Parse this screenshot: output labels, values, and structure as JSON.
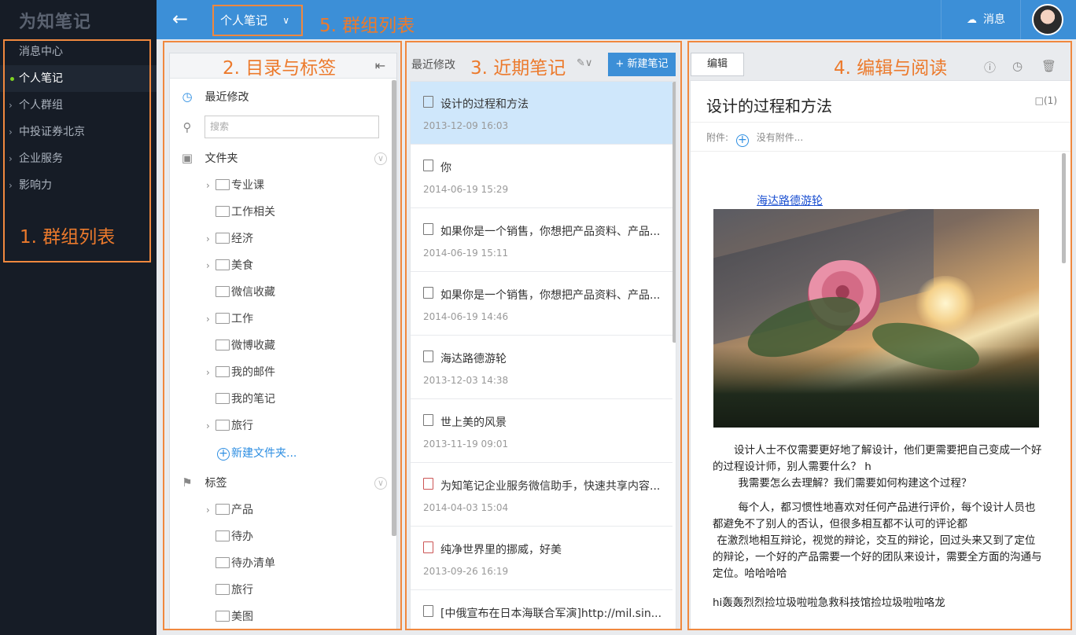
{
  "app": {
    "logo": "为知笔记"
  },
  "sidebar": {
    "items": [
      {
        "label": "消息中心",
        "chevron": false,
        "active": false
      },
      {
        "label": "个人笔记",
        "chevron": false,
        "active": true
      },
      {
        "label": "个人群组",
        "chevron": true,
        "active": false
      },
      {
        "label": "中投证券北京",
        "chevron": true,
        "active": false
      },
      {
        "label": "企业服务",
        "chevron": true,
        "active": false
      },
      {
        "label": "影响力",
        "chevron": true,
        "active": false
      }
    ]
  },
  "annotations": {
    "a1": "1. 群组列表",
    "a2": "2. 目录与标签",
    "a3": "3. 近期笔记",
    "a4": "4. 编辑与阅读",
    "a5": "5. 群组列表",
    "color": "#f0883e"
  },
  "topbar": {
    "back_icon": "←",
    "group_selected": "个人笔记",
    "message_label": "消息",
    "accent": "#3c8fd7"
  },
  "directory": {
    "recent_label": "最近修改",
    "search_placeholder": "搜索",
    "folders_label": "文件夹",
    "folders": [
      {
        "label": "专业课",
        "chevron": true
      },
      {
        "label": "工作相关",
        "chevron": false
      },
      {
        "label": "经济",
        "chevron": true
      },
      {
        "label": "美食",
        "chevron": true
      },
      {
        "label": "微信收藏",
        "chevron": false
      },
      {
        "label": "工作",
        "chevron": true
      },
      {
        "label": "微博收藏",
        "chevron": false
      },
      {
        "label": "我的邮件",
        "chevron": true
      },
      {
        "label": "我的笔记",
        "chevron": false
      },
      {
        "label": "旅行",
        "chevron": true
      }
    ],
    "new_folder_label": "新建文件夹...",
    "tags_label": "标签",
    "tags": [
      {
        "label": "产品",
        "chevron": true
      },
      {
        "label": "待办",
        "chevron": false
      },
      {
        "label": "待办清单",
        "chevron": false
      },
      {
        "label": "旅行",
        "chevron": false
      },
      {
        "label": "美图",
        "chevron": false
      }
    ]
  },
  "notes": {
    "header": "最近修改",
    "new_note_label": "+ 新建笔记",
    "items": [
      {
        "title": "设计的过程和方法",
        "date": "2013-12-09 16:03",
        "selected": true,
        "attachment": false
      },
      {
        "title": "你",
        "date": "2014-06-19 15:29",
        "selected": false,
        "attachment": false
      },
      {
        "title": "如果你是一个销售，你想把产品资料、产品...",
        "date": "2014-06-19 15:11",
        "selected": false,
        "attachment": false
      },
      {
        "title": "如果你是一个销售，你想把产品资料、产品...",
        "date": "2014-06-19 14:46",
        "selected": false,
        "attachment": false
      },
      {
        "title": "海达路德游轮",
        "date": "2013-12-03 14:38",
        "selected": false,
        "attachment": false
      },
      {
        "title": "世上美的风景",
        "date": "2013-11-19 09:01",
        "selected": false,
        "attachment": false
      },
      {
        "title": "为知笔记企业服务微信助手，快速共享内容...",
        "date": "2014-04-03 15:04",
        "selected": false,
        "attachment": true
      },
      {
        "title": "纯净世界里的挪威，好美",
        "date": "2013-09-26 16:19",
        "selected": false,
        "attachment": true
      },
      {
        "title": "[中俄宣布在日本海联合军演]http://mil.sin...",
        "date": "",
        "selected": false,
        "attachment": false
      }
    ]
  },
  "editor": {
    "edit_label": "编辑",
    "title": "设计的过程和方法",
    "comments": "(1)",
    "attach_label": "附件:",
    "no_attach": "没有附件...",
    "link_text": "海达路德游轮",
    "paragraphs": [
      "设计人士不仅需要更好地了解设计，他们更需要把自己变成一个好的过程设计师，别人需要什么？ h",
      "我需要怎么去理解？我们需要如何构建这个过程？",
      "每个人，都习惯性地喜欢对任何产品进行评价，每个设计人员也都避免不了别人的否认，但很多相互都不认可的评论都",
      "在激烈地相互辩论，视觉的辩论，交互的辩论，回过头来又到了定位的辩论，一个好的产品需要一个好的团队来设计，需要全方面的沟通与定位。哈哈哈哈",
      "hi轰轰烈烈捡垃圾啦啦急救科技馆捡垃圾啦啦咯龙"
    ]
  }
}
